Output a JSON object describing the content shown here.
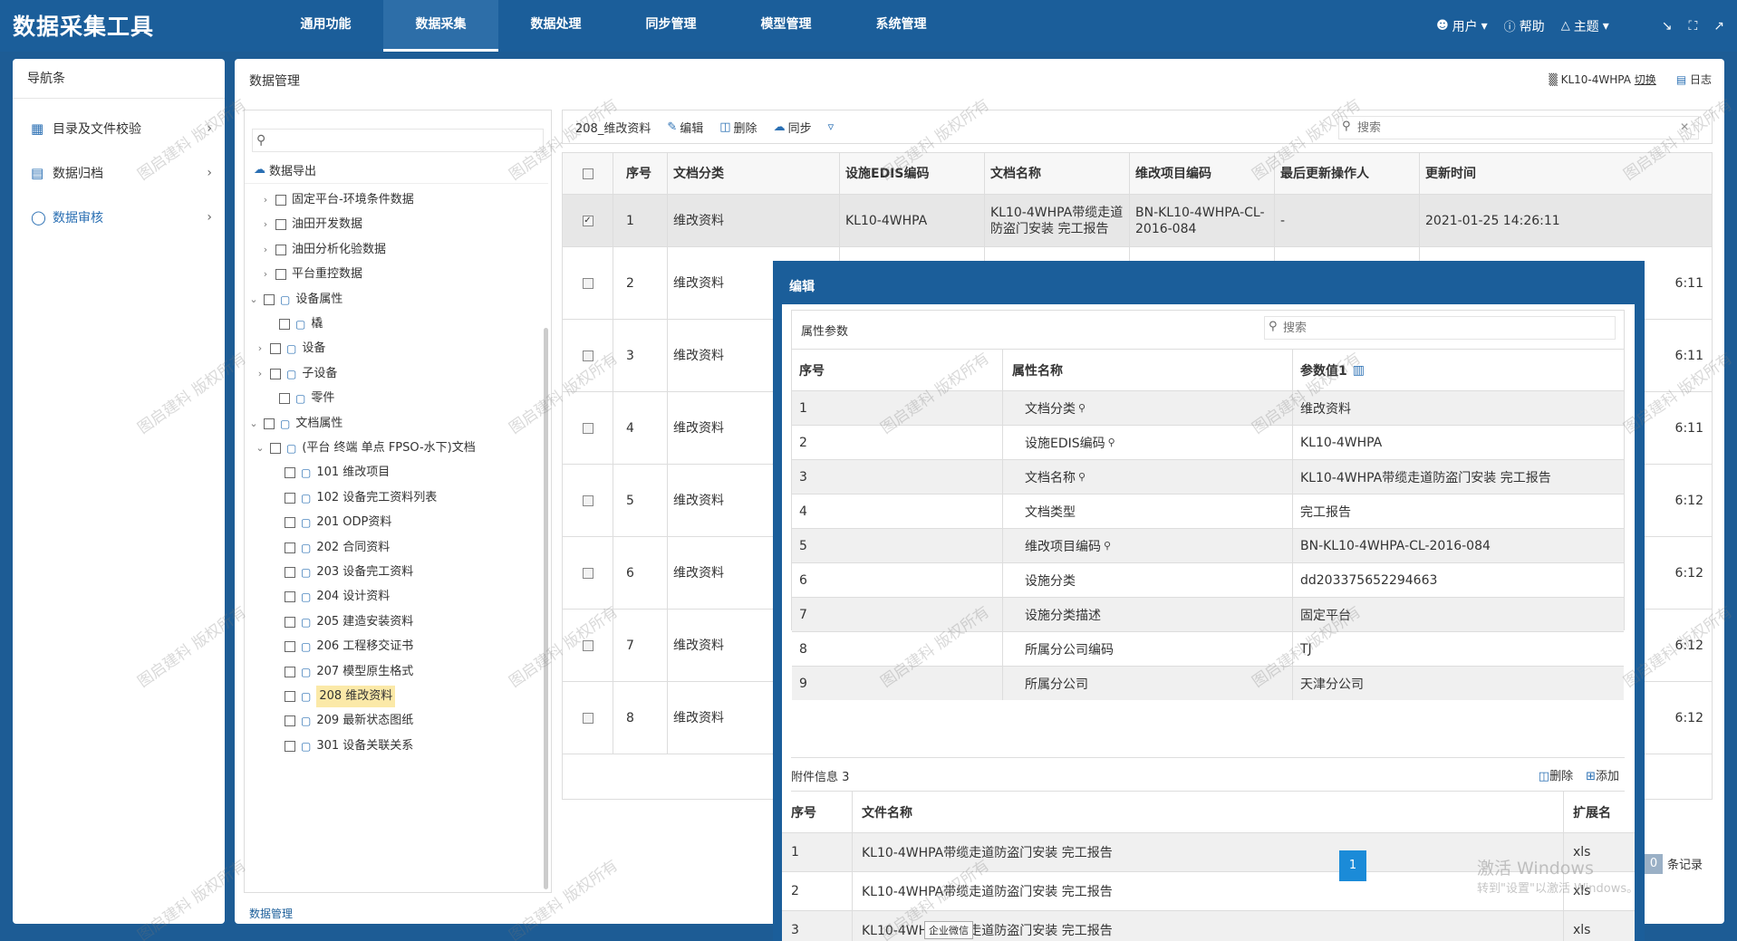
{
  "app_title": "数据采集工具",
  "nav": [
    "通用功能",
    "数据采集",
    "数据处理",
    "同步管理",
    "模型管理",
    "系统管理"
  ],
  "nav_active_index": 1,
  "topright": {
    "user": "用户",
    "help": "帮助",
    "theme": "主题"
  },
  "sidebar": {
    "title": "导航条",
    "items": [
      {
        "label": "目录及文件校验"
      },
      {
        "label": "数据归档"
      },
      {
        "label": "数据审核",
        "active": true
      }
    ]
  },
  "main": {
    "title": "数据管理",
    "facility": "KL10-4WHPA",
    "switch_label": "切换",
    "log_label": "日志",
    "bottom_tab": "数据管理"
  },
  "tree": {
    "search_placeholder": "",
    "export_label": "数据导出",
    "rows": [
      {
        "label": "固定平台-环境条件数据",
        "expander": "›",
        "folder": false
      },
      {
        "label": "油田开发数据",
        "expander": "›",
        "folder": false
      },
      {
        "label": "油田分析化验数据",
        "expander": "›",
        "folder": false
      },
      {
        "label": "平台重控数据",
        "expander": "›",
        "folder": false
      },
      {
        "label": "设备属性",
        "expander": "⌄",
        "folder": true
      },
      {
        "label": "橇",
        "expander": "",
        "folder": true
      },
      {
        "label": "设备",
        "expander": "›",
        "folder": true
      },
      {
        "label": "子设备",
        "expander": "›",
        "folder": true
      },
      {
        "label": "零件",
        "expander": "",
        "folder": true
      },
      {
        "label": "文档属性",
        "expander": "⌄",
        "folder": true
      },
      {
        "label": "(平台 终端 单点 FPSO-水下)文档",
        "expander": "⌄",
        "folder": true
      },
      {
        "label": "101  维改项目",
        "expander": "",
        "folder": true
      },
      {
        "label": "102  设备完工资料列表",
        "expander": "",
        "folder": true
      },
      {
        "label": "201  ODP资料",
        "expander": "",
        "folder": true
      },
      {
        "label": "202  合同资料",
        "expander": "",
        "folder": true
      },
      {
        "label": "203  设备完工资料",
        "expander": "",
        "folder": true
      },
      {
        "label": "204  设计资料",
        "expander": "",
        "folder": true
      },
      {
        "label": "205  建造安装资料",
        "expander": "",
        "folder": true
      },
      {
        "label": "206  工程移交证书",
        "expander": "",
        "folder": true
      },
      {
        "label": "207  模型原生格式",
        "expander": "",
        "folder": true
      },
      {
        "label": "208  维改资料",
        "expander": "",
        "folder": true,
        "selected": true
      },
      {
        "label": "209  最新状态图纸",
        "expander": "",
        "folder": true
      },
      {
        "label": "301  设备关联关系",
        "expander": "",
        "folder": true
      }
    ]
  },
  "toolbar": {
    "current": "208_维改资料",
    "edit": "编辑",
    "delete": "删除",
    "sync": "同步",
    "search_placeholder": "搜索"
  },
  "grid": {
    "columns": [
      "",
      "序号",
      "文档分类",
      "设施EDIS编码",
      "文档名称",
      "维改项目编码",
      "最后更新操作人",
      "更新时间"
    ],
    "rows": [
      {
        "no": "1",
        "category": "维改资料",
        "edis": "KL10-4WHPA",
        "name": "KL10-4WHPA带缆走道防盗门安装 完工报告",
        "proj": "BN-KL10-4WHPA-CL-2016-084",
        "operator": "-",
        "time": "2021-01-25 14:26:11",
        "checked": true
      },
      {
        "no": "2",
        "category": "维改资料",
        "time_tail": "6:11"
      },
      {
        "no": "3",
        "category": "维改资料",
        "time_tail": "6:11"
      },
      {
        "no": "4",
        "category": "维改资料",
        "time_tail": "6:11"
      },
      {
        "no": "5",
        "category": "维改资料",
        "time_tail": "6:12"
      },
      {
        "no": "6",
        "category": "维改资料",
        "time_tail": "6:12"
      },
      {
        "no": "7",
        "category": "维改资料",
        "time_tail": "6:12"
      },
      {
        "no": "8",
        "category": "维改资料",
        "time_tail": "6:12"
      }
    ]
  },
  "pager": {
    "page": "1",
    "total_prefix": "0",
    "total_label": "条记录"
  },
  "modal": {
    "title": "编辑",
    "props_title": "属性参数",
    "props_search_placeholder": "搜索",
    "props_columns": [
      "序号",
      "属性名称",
      "参数值1"
    ],
    "props": [
      {
        "no": "1",
        "name": "文档分类",
        "key": true,
        "value": "维改资料"
      },
      {
        "no": "2",
        "name": "设施EDIS编码",
        "key": true,
        "value": "KL10-4WHPA"
      },
      {
        "no": "3",
        "name": "文档名称",
        "key": true,
        "value": "KL10-4WHPA带缆走道防盗门安装 完工报告"
      },
      {
        "no": "4",
        "name": "文档类型",
        "key": false,
        "value": "完工报告"
      },
      {
        "no": "5",
        "name": "维改项目编码",
        "key": true,
        "value": "BN-KL10-4WHPA-CL-2016-084"
      },
      {
        "no": "6",
        "name": "设施分类",
        "key": false,
        "value": "dd203375652294663"
      },
      {
        "no": "7",
        "name": "设施分类描述",
        "key": false,
        "value": "固定平台"
      },
      {
        "no": "8",
        "name": "所属分公司编码",
        "key": false,
        "value": "TJ"
      },
      {
        "no": "9",
        "name": "所属分公司",
        "key": false,
        "value": "天津分公司"
      }
    ],
    "attach_title": "附件信息 3",
    "attach_delete": "删除",
    "attach_add": "添加",
    "attach_columns": [
      "序号",
      "文件名称",
      "扩展名"
    ],
    "attachments": [
      {
        "no": "1",
        "name": "KL10-4WHPA带缆走道防盗门安装 完工报告",
        "ext": "xls"
      },
      {
        "no": "2",
        "name": "KL10-4WHPA带缆走道防盗门安装 完工报告",
        "ext": "xls"
      },
      {
        "no": "3",
        "name": "KL10-4WHPA带缆走道防盗门安装 完工报告",
        "ext": "xls"
      }
    ]
  },
  "overlay": {
    "watermark": "图启建科 版权所有",
    "windows_activate": "激活 Windows",
    "windows_activate_sub": "转到\"设置\"以激活 Windows。",
    "wechat": "企业微信"
  },
  "icons": {
    "user": "user-icon",
    "help": "help-icon",
    "theme": "shirt-icon",
    "shrink": "shrink-icon",
    "fullscreen": "fullscreen-icon",
    "external": "external-link-icon"
  },
  "colors": {
    "topbar": "#1b5e9a",
    "accent": "#2a6fb3",
    "selected_tree": "#fbe9a8",
    "pager": "#1b8bd8"
  }
}
